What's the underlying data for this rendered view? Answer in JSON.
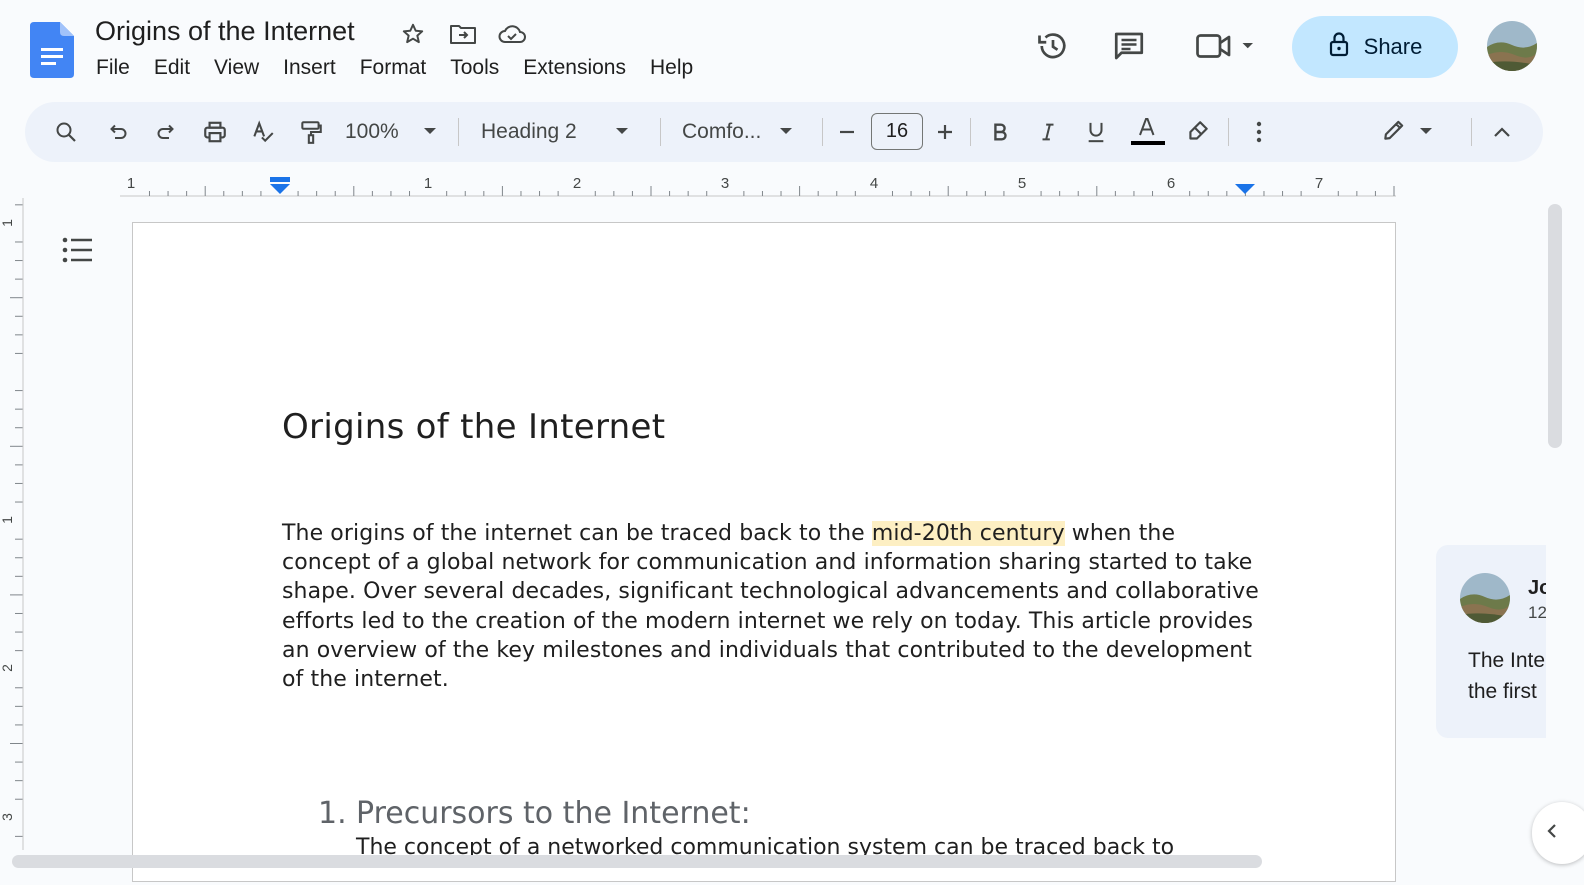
{
  "header": {
    "doc_title": "Origins of the Internet",
    "menu": [
      "File",
      "Edit",
      "View",
      "Insert",
      "Format",
      "Tools",
      "Extensions",
      "Help"
    ],
    "share_label": "Share",
    "icons": [
      "star-icon",
      "move-folder-icon",
      "cloud-saved-icon",
      "version-history-icon",
      "comments-icon",
      "meet-camera-icon"
    ]
  },
  "toolbar": {
    "zoom": "100%",
    "style": "Heading 2",
    "font": "Comfo...",
    "font_size": "16"
  },
  "ruler": {
    "labels": [
      "1",
      "1",
      "2",
      "3",
      "4",
      "5",
      "6",
      "7"
    ],
    "vlabels": [
      "1",
      "1",
      "2",
      "3"
    ]
  },
  "document": {
    "title": "Origins of the Internet",
    "paragraph_before": "The origins of the internet can be traced back to the ",
    "paragraph_highlight": "mid-20th century",
    "paragraph_after": " when the concept of a global network for communication and information sharing started to take shape. Over several decades, significant technological advancements and collaborative efforts led to the creation of the modern internet we rely on today. This article provides an overview of the key milestones and individuals that contributed to the development of the internet.",
    "section_number": "1.",
    "section_title": "Precursors to the Internet:",
    "section_text_cut": "The concept of a networked communication system can be traced back to"
  },
  "comment": {
    "author_partial": "Jo",
    "time_partial": "12",
    "text_line1": "The Inte",
    "text_line2": "the first"
  },
  "colors": {
    "share_bg": "#c2e7ff",
    "toolbar_bg": "#edf2fa",
    "highlight": "#fdefc3",
    "docs_blue": "#4285f4",
    "ruler_marker": "#1a73e8"
  }
}
